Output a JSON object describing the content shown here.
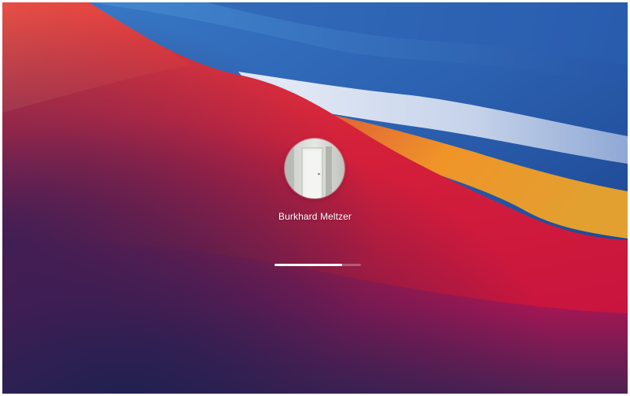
{
  "login_screen": {
    "user": {
      "name": "Burkhard Meltzer",
      "avatar": "door-photo-avatar"
    },
    "progress": {
      "fraction": 0.78
    },
    "wallpaper": {
      "name": "macos-big-sur-wallpaper",
      "colors": {
        "sky_blue": "#2f66b8",
        "light_band": "#c9d6ea",
        "orange_band": "#e68a24",
        "red": "#d7223a",
        "magenta": "#9a1756",
        "deep_purple": "#24214f"
      }
    }
  }
}
